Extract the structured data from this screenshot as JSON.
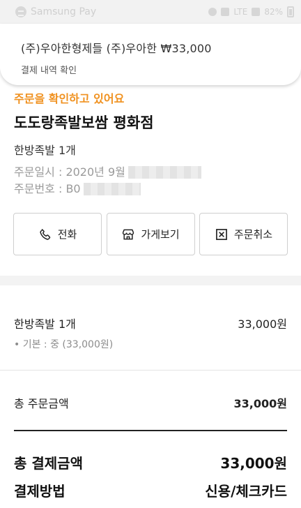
{
  "status_bar": {
    "app_label": "Samsung Pay",
    "network": "LTE",
    "battery": "82%"
  },
  "notification": {
    "title": "(주)우아한형제들 (주)우아한 ₩33,000",
    "subtitle": "결제 내역 확인"
  },
  "order": {
    "status": "주문을 확인하고 있어요",
    "store_name": "도도랑족발보쌈 평화점",
    "summary": "한방족발 1개",
    "order_date_label": "주문일시 : 2020년 9월",
    "order_number_label": "주문번호 : B0"
  },
  "actions": {
    "call_label": "전화",
    "store_label": "가게보기",
    "cancel_label": "주문취소"
  },
  "items": {
    "name": "한방족발 1개",
    "price": "33,000원",
    "option": "• 기본 : 중 (33,000원)"
  },
  "totals": {
    "order_total_label": "총 주문금액",
    "order_total_value": "33,000원",
    "payment_total_label": "총 결제금액",
    "payment_total_value": "33,000원",
    "payment_method_label": "결제방법",
    "payment_method_value": "신용/체크카드"
  },
  "colors": {
    "accent": "#f0911f"
  }
}
